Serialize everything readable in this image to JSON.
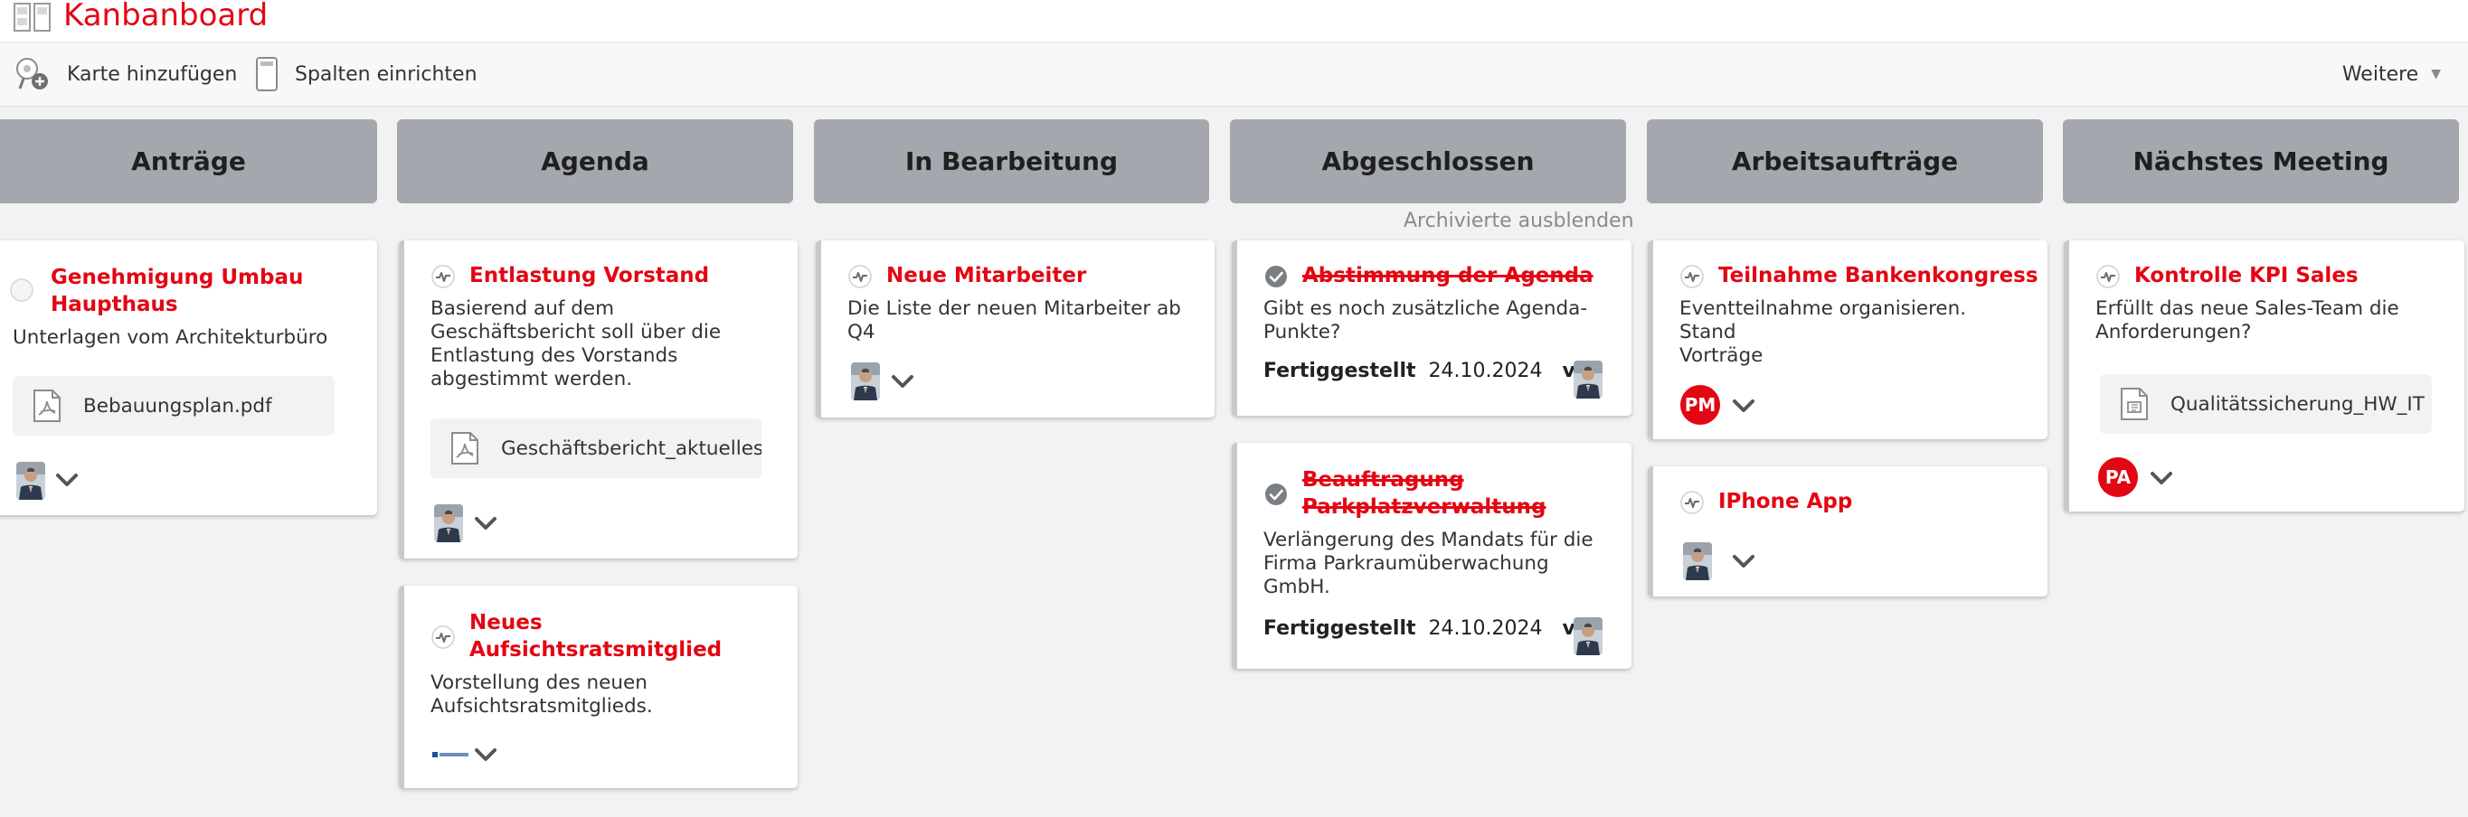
{
  "app": {
    "title": "Kanbanboard"
  },
  "toolbar": {
    "add_card": "Karte hinzufügen",
    "setup_columns": "Spalten einrichten",
    "more": "Weitere"
  },
  "archive_toggle": "Archivierte ausblenden",
  "columns": [
    {
      "title": "Anträge"
    },
    {
      "title": "Agenda"
    },
    {
      "title": "In Bearbeitung"
    },
    {
      "title": "Abgeschlossen"
    },
    {
      "title": "Arbeitsaufträge"
    },
    {
      "title": "Nächstes Meeting"
    }
  ],
  "cards": {
    "umbau": {
      "title_l1": "Genehmigung Umbau",
      "title_l2": "Haupthaus",
      "desc": "Unterlagen vom Architekturbüro",
      "attachment": "Bebauungsplan.pdf"
    },
    "entlastung": {
      "title": "Entlastung Vorstand",
      "desc_l1": "Basierend auf dem",
      "desc_l2": "Geschäftsbericht soll über die",
      "desc_l3": "Entlastung des Vorstands",
      "desc_l4": "abgestimmt werden.",
      "attachment": "Geschäftsbericht_aktuelles_Jahr.pdf"
    },
    "aufsichtsrat": {
      "title_l1": "Neues",
      "title_l2": "Aufsichtsratsmitglied",
      "desc_l1": "Vorstellung des neuen",
      "desc_l2": "Aufsichtsratsmitglieds."
    },
    "mitarbeiter": {
      "title": "Neue Mitarbeiter",
      "desc_l1": "Die Liste der neuen Mitarbeiter ab",
      "desc_l2": "Q4"
    },
    "agenda_vote": {
      "title": "Abstimmung der Agenda",
      "desc_l1": "Gibt es noch zusätzliche Agenda-",
      "desc_l2": "Punkte?",
      "done_label": "Fertiggestellt",
      "done_date": "24.10.2024",
      "by": "von"
    },
    "parkplatz": {
      "title_l1": "Beauftragung",
      "title_l2": "Parkplatzverwaltung",
      "desc_l1": "Verlängerung des Mandats für die",
      "desc_l2": "Firma Parkraumüberwachung",
      "desc_l3": "GmbH.",
      "done_label": "Fertiggestellt",
      "done_date": "24.10.2024",
      "by": "von"
    },
    "banken": {
      "title": "Teilnahme Bankenkongress",
      "desc_l1": "Eventteilnahme organisieren.",
      "desc_l2": "Stand",
      "desc_l3": "Vorträge",
      "assignee": "PM"
    },
    "iphone": {
      "title": "IPhone App"
    },
    "kpi": {
      "title": "Kontrolle KPI Sales",
      "desc_l1": "Erfüllt das neue Sales-Team die",
      "desc_l2": "Anforderungen?",
      "attachment": "Qualitätssicherung_HW_IT",
      "assignee": "PA"
    }
  },
  "colors": {
    "accent": "#e30613",
    "column_header": "#a4a8ae",
    "background": "#f2f2f2"
  },
  "icons": [
    "board-icon",
    "add-card-icon",
    "columns-icon",
    "status-in-progress-icon",
    "status-done-icon",
    "pdf-icon",
    "file-icon",
    "chevron-down-icon"
  ]
}
